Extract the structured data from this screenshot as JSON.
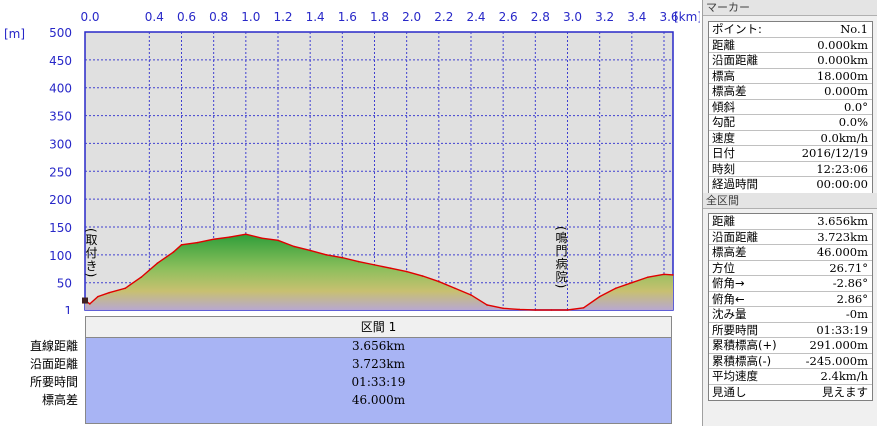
{
  "profile": {
    "unit_elevation": "[m]",
    "unit_distance": "[km]",
    "x_tick_labels": [
      "0.0",
      "0.4",
      "0.6",
      "0.8",
      "1.0",
      "1.2",
      "1.4",
      "1.6",
      "1.8",
      "2.0",
      "2.2",
      "2.4",
      "2.6",
      "2.8",
      "3.0",
      "3.2",
      "3.4",
      "3.6"
    ],
    "y_tick_labels": [
      "500",
      "450",
      "400",
      "350",
      "300",
      "250",
      "200",
      "150",
      "100",
      "50",
      "1"
    ],
    "place_label_1": "(取付き)",
    "place_label_2": "(鳴門病院)"
  },
  "chart_data": {
    "type": "area",
    "title": "",
    "xlabel": "[km]",
    "ylabel": "[m]",
    "xlim": [
      0.0,
      3.656
    ],
    "ylim": [
      1,
      500
    ],
    "x": [
      0.0,
      0.03,
      0.08,
      0.15,
      0.25,
      0.35,
      0.45,
      0.55,
      0.6,
      0.7,
      0.8,
      0.9,
      1.0,
      1.1,
      1.2,
      1.3,
      1.4,
      1.5,
      1.6,
      1.7,
      1.8,
      1.9,
      2.0,
      2.1,
      2.2,
      2.3,
      2.4,
      2.5,
      2.6,
      2.7,
      2.8,
      2.9,
      3.0,
      3.1,
      3.2,
      3.3,
      3.4,
      3.5,
      3.6,
      3.656
    ],
    "y": [
      18,
      12,
      25,
      32,
      40,
      60,
      85,
      105,
      118,
      122,
      128,
      132,
      137,
      130,
      126,
      115,
      108,
      100,
      95,
      88,
      82,
      76,
      70,
      62,
      52,
      40,
      28,
      10,
      4,
      2,
      1,
      1,
      1,
      5,
      25,
      40,
      50,
      60,
      65,
      64
    ],
    "grid": true,
    "fill": "gradient"
  },
  "summary": {
    "section_title": "区間 1",
    "rows": [
      {
        "label": "直線距離",
        "value": "3.656km"
      },
      {
        "label": "沿面距離",
        "value": "3.723km"
      },
      {
        "label": "所要時間",
        "value": "01:33:19"
      },
      {
        "label": "標高差",
        "value": "46.000m"
      }
    ]
  },
  "marker_panel": {
    "header": "マーカー",
    "rows": [
      {
        "k": "ポイント:",
        "v": "No.1"
      },
      {
        "k": "距離",
        "v": "0.000km"
      },
      {
        "k": "沿面距離",
        "v": "0.000km"
      },
      {
        "k": "標高",
        "v": "18.000m"
      },
      {
        "k": "標高差",
        "v": "0.000m"
      },
      {
        "k": "傾斜",
        "v": "0.0°"
      },
      {
        "k": "勾配",
        "v": "0.0%"
      },
      {
        "k": "速度",
        "v": "0.0km/h"
      },
      {
        "k": "日付",
        "v": "2016/12/19"
      },
      {
        "k": "時刻",
        "v": "12:23:06"
      },
      {
        "k": "経過時間",
        "v": "00:00:00"
      }
    ]
  },
  "total_panel": {
    "header": "全区間",
    "rows": [
      {
        "k": "距離",
        "v": "3.656km"
      },
      {
        "k": "沿面距離",
        "v": "3.723km"
      },
      {
        "k": "標高差",
        "v": "46.000m"
      },
      {
        "k": "方位",
        "v": "26.71°"
      },
      {
        "k": "俯角→",
        "v": "-2.86°"
      },
      {
        "k": "俯角←",
        "v": "2.86°"
      },
      {
        "k": "沈み量",
        "v": "-0m"
      },
      {
        "k": "所要時間",
        "v": "01:33:19"
      },
      {
        "k": "累積標高(+)",
        "v": "291.000m"
      },
      {
        "k": "累積標高(-)",
        "v": "-245.000m"
      },
      {
        "k": "平均速度",
        "v": "2.4km/h"
      },
      {
        "k": "見通し",
        "v": "見えます"
      }
    ]
  },
  "colors": {
    "axis_text": "#2828c8",
    "plot_bg": "#e0e0e0",
    "grid": "#4040d0",
    "profile_line": "#e00000",
    "fill_top": "#3cb43c",
    "fill_bottom": "#b4a0c8",
    "summary_bg": "#a8b4f4"
  }
}
